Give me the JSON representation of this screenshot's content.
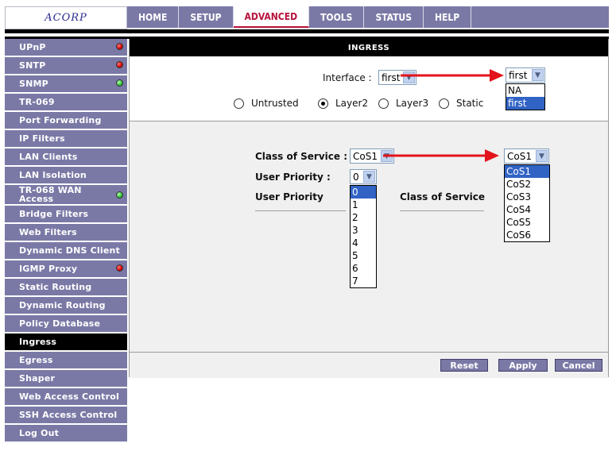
{
  "logo": {
    "text": "ACORP"
  },
  "topnav": {
    "tabs": [
      {
        "label": "HOME"
      },
      {
        "label": "SETUP"
      },
      {
        "label": "ADVANCED",
        "active": true
      },
      {
        "label": "TOOLS"
      },
      {
        "label": "STATUS"
      },
      {
        "label": "HELP"
      }
    ]
  },
  "sidebar": {
    "items": [
      {
        "label": "UPnP",
        "status": "red"
      },
      {
        "label": "SNTP",
        "status": "red"
      },
      {
        "label": "SNMP",
        "status": "green"
      },
      {
        "label": "TR-069"
      },
      {
        "label": "Port Forwarding"
      },
      {
        "label": "IP Filters"
      },
      {
        "label": "LAN Clients"
      },
      {
        "label": "LAN Isolation"
      },
      {
        "label": "TR-068 WAN Access",
        "status": "green"
      },
      {
        "label": "Bridge Filters"
      },
      {
        "label": "Web Filters"
      },
      {
        "label": "Dynamic DNS Client"
      },
      {
        "label": "IGMP Proxy",
        "status": "red"
      },
      {
        "label": "Static Routing"
      },
      {
        "label": "Dynamic Routing"
      },
      {
        "label": "Policy Database"
      },
      {
        "label": "Ingress",
        "active": true
      },
      {
        "label": "Egress"
      },
      {
        "label": "Shaper"
      },
      {
        "label": "Web Access Control"
      },
      {
        "label": "SSH Access Control"
      },
      {
        "label": "Log Out"
      }
    ]
  },
  "panel": {
    "title": "INGRESS",
    "interface": {
      "label": "Interface :",
      "value": "first",
      "callout_value": "first",
      "options": [
        "NA",
        "first"
      ],
      "selected_option": "first"
    },
    "radios": [
      {
        "label": "Untrusted",
        "checked": false
      },
      {
        "label": "Layer2",
        "checked": true
      },
      {
        "label": "Layer3",
        "checked": false
      },
      {
        "label": "Static",
        "checked": false
      }
    ],
    "cos": {
      "label": "Class of Service :",
      "value": "CoS1",
      "callout_value": "CoS1",
      "options": [
        "CoS1",
        "CoS2",
        "CoS3",
        "CoS4",
        "CoS5",
        "CoS6"
      ],
      "selected_option": "CoS1"
    },
    "priority": {
      "label": "User Priority :",
      "value": "0",
      "options": [
        "0",
        "1",
        "2",
        "3",
        "4",
        "5",
        "6",
        "7"
      ],
      "selected_option": "0"
    },
    "table_headers": {
      "user_priority": "User Priority",
      "class_of_service": "Class of Service"
    },
    "buttons": {
      "reset": "Reset",
      "apply": "Apply",
      "cancel": "Cancel"
    }
  },
  "colors": {
    "nav_bg": "#7a79a6",
    "active_tab_text": "#b6123c",
    "arrow": "#e3131b",
    "selection": "#3163c5"
  }
}
